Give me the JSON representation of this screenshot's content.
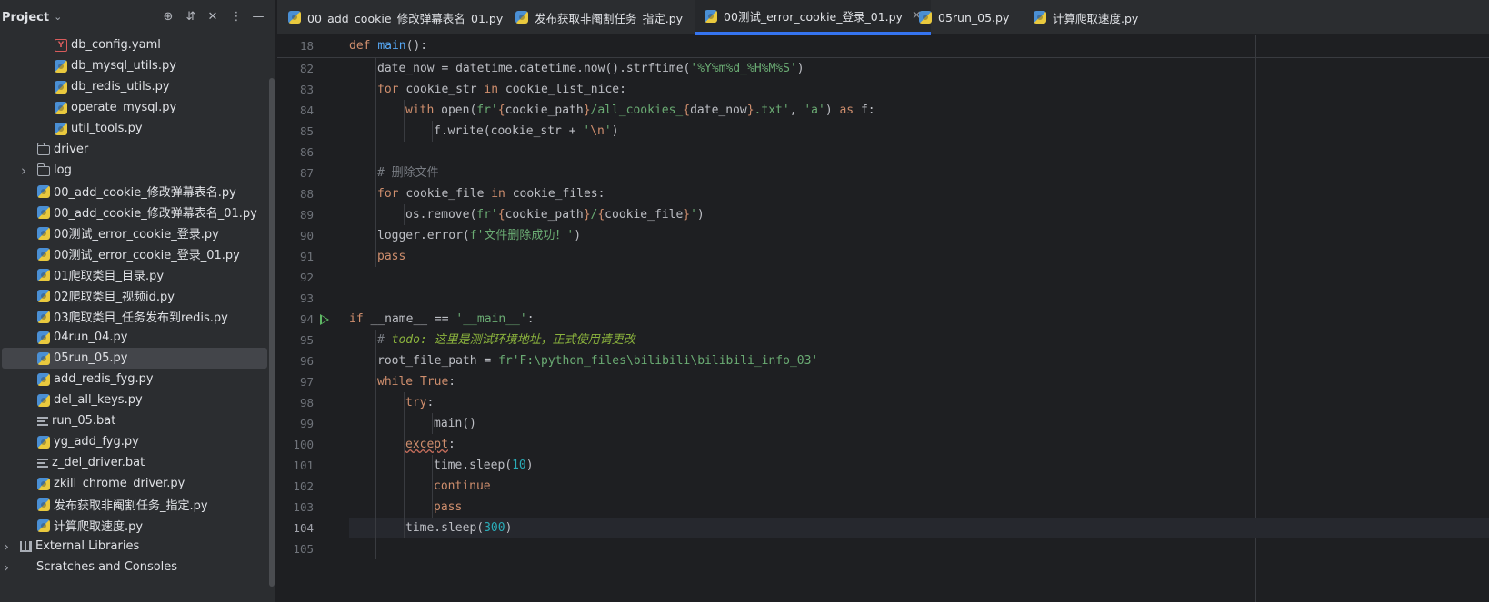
{
  "project_panel": {
    "title": "Project",
    "icons": [
      "locate-icon",
      "expand-all-icon",
      "collapse-all-icon",
      "more-options-icon",
      "minimize-icon"
    ],
    "tree": [
      {
        "label": "db_config.yaml",
        "icon": "yaml-file-icon",
        "indent": 60,
        "kind": "file"
      },
      {
        "label": "db_mysql_utils.py",
        "icon": "python-file-icon",
        "indent": 60,
        "kind": "file"
      },
      {
        "label": "db_redis_utils.py",
        "icon": "python-file-icon",
        "indent": 60,
        "kind": "file"
      },
      {
        "label": "operate_mysql.py",
        "icon": "python-file-icon",
        "indent": 60,
        "kind": "file"
      },
      {
        "label": "util_tools.py",
        "icon": "python-file-icon",
        "indent": 60,
        "kind": "file"
      },
      {
        "label": "driver",
        "icon": "folder-icon",
        "indent": 41,
        "kind": "folder"
      },
      {
        "label": "log",
        "icon": "folder-icon",
        "indent": 41,
        "kind": "folder",
        "expandable": true
      },
      {
        "label": "00_add_cookie_修改弹幕表名.py",
        "icon": "python-file-icon",
        "indent": 41,
        "kind": "file"
      },
      {
        "label": "00_add_cookie_修改弹幕表名_01.py",
        "icon": "python-file-icon",
        "indent": 41,
        "kind": "file"
      },
      {
        "label": "00测试_error_cookie_登录.py",
        "icon": "python-file-icon",
        "indent": 41,
        "kind": "file"
      },
      {
        "label": "00测试_error_cookie_登录_01.py",
        "icon": "python-file-icon",
        "indent": 41,
        "kind": "file"
      },
      {
        "label": "01爬取类目_目录.py",
        "icon": "python-file-icon",
        "indent": 41,
        "kind": "file"
      },
      {
        "label": "02爬取类目_视频id.py",
        "icon": "python-file-icon",
        "indent": 41,
        "kind": "file"
      },
      {
        "label": "03爬取类目_任务发布到redis.py",
        "icon": "python-file-icon",
        "indent": 41,
        "kind": "file"
      },
      {
        "label": "04run_04.py",
        "icon": "python-file-icon",
        "indent": 41,
        "kind": "file"
      },
      {
        "label": "05run_05.py",
        "icon": "python-file-icon",
        "indent": 41,
        "kind": "file",
        "selected": true
      },
      {
        "label": "add_redis_fyg.py",
        "icon": "python-file-icon",
        "indent": 41,
        "kind": "file"
      },
      {
        "label": "del_all_keys.py",
        "icon": "python-file-icon",
        "indent": 41,
        "kind": "file"
      },
      {
        "label": "run_05.bat",
        "icon": "bat-file-icon",
        "indent": 41,
        "kind": "file"
      },
      {
        "label": "yg_add_fyg.py",
        "icon": "python-file-icon",
        "indent": 41,
        "kind": "file"
      },
      {
        "label": "z_del_driver.bat",
        "icon": "bat-file-icon",
        "indent": 41,
        "kind": "file"
      },
      {
        "label": "zkill_chrome_driver.py",
        "icon": "python-file-icon",
        "indent": 41,
        "kind": "file"
      },
      {
        "label": "发布获取非阉割任务_指定.py",
        "icon": "python-file-icon",
        "indent": 41,
        "kind": "file"
      },
      {
        "label": "计算爬取速度.py",
        "icon": "python-file-icon",
        "indent": 41,
        "kind": "file"
      },
      {
        "label": "External Libraries",
        "icon": "library-icon",
        "indent": 22,
        "kind": "root",
        "expandable": true
      },
      {
        "label": "Scratches and Consoles",
        "icon": "scratches-icon",
        "indent": 22,
        "kind": "root",
        "expandable": true
      }
    ]
  },
  "tabs": [
    {
      "label": "00_add_cookie_修改弹幕表名_01.py",
      "active": false
    },
    {
      "label": "发布获取非阉割任务_指定.py",
      "active": false
    },
    {
      "label": "00测试_error_cookie_登录_01.py",
      "active": true
    },
    {
      "label": "05run_05.py",
      "active": false
    },
    {
      "label": "计算爬取速度.py",
      "active": false
    }
  ],
  "editor": {
    "current_line": "104",
    "run_marker_line": "94",
    "lines": [
      {
        "n": "18",
        "indent": 0,
        "tokens": [
          [
            "kw",
            "def "
          ],
          [
            "fn",
            "main"
          ],
          [
            "",
            "():"
          ]
        ]
      },
      {
        "n": "82",
        "indent": 1,
        "tokens": [
          [
            "",
            "date_now = datetime.datetime.now().strftime("
          ],
          [
            "str",
            "'%Y%m%d_%H%M%S'"
          ],
          [
            "",
            ")"
          ]
        ]
      },
      {
        "n": "83",
        "indent": 1,
        "tokens": [
          [
            "kw",
            "for "
          ],
          [
            "",
            "cookie_str "
          ],
          [
            "kw",
            "in "
          ],
          [
            "",
            "cookie_list_nice:"
          ]
        ]
      },
      {
        "n": "84",
        "indent": 2,
        "tokens": [
          [
            "kw",
            "with "
          ],
          [
            "",
            "open("
          ],
          [
            "str",
            "fr'"
          ],
          [
            "fmt",
            "{"
          ],
          [
            "",
            "cookie_path"
          ],
          [
            "fmt",
            "}"
          ],
          [
            "str",
            "/all_cookies_"
          ],
          [
            "fmt",
            "{"
          ],
          [
            "",
            "date_now"
          ],
          [
            "fmt",
            "}"
          ],
          [
            "str",
            ".txt'"
          ],
          [
            "",
            ", "
          ],
          [
            "str",
            "'a'"
          ],
          [
            "",
            ") "
          ],
          [
            "kw",
            "as "
          ],
          [
            "",
            "f:"
          ]
        ]
      },
      {
        "n": "85",
        "indent": 3,
        "tokens": [
          [
            "",
            "f.write(cookie_str + "
          ],
          [
            "str",
            "'"
          ],
          [
            "esc",
            "\\n"
          ],
          [
            "str",
            "'"
          ],
          [
            "",
            ")"
          ]
        ]
      },
      {
        "n": "86",
        "indent": 0,
        "tokens": []
      },
      {
        "n": "87",
        "indent": 1,
        "tokens": [
          [
            "cmt",
            "# 删除文件"
          ]
        ]
      },
      {
        "n": "88",
        "indent": 1,
        "tokens": [
          [
            "kw",
            "for "
          ],
          [
            "",
            "cookie_file "
          ],
          [
            "kw",
            "in "
          ],
          [
            "",
            "cookie_files:"
          ]
        ]
      },
      {
        "n": "89",
        "indent": 2,
        "tokens": [
          [
            "",
            "os.remove("
          ],
          [
            "str",
            "fr'"
          ],
          [
            "fmt",
            "{"
          ],
          [
            "",
            "cookie_path"
          ],
          [
            "fmt",
            "}"
          ],
          [
            "str",
            "/"
          ],
          [
            "fmt",
            "{"
          ],
          [
            "",
            "cookie_file"
          ],
          [
            "fmt",
            "}"
          ],
          [
            "str",
            "'"
          ],
          [
            "",
            ")"
          ]
        ]
      },
      {
        "n": "90",
        "indent": 1,
        "tokens": [
          [
            "",
            "logger.error("
          ],
          [
            "str",
            "f'文件删除成功！'"
          ],
          [
            "",
            ")"
          ]
        ]
      },
      {
        "n": "91",
        "indent": 1,
        "tokens": [
          [
            "kw",
            "pass"
          ]
        ]
      },
      {
        "n": "92",
        "indent": 0,
        "tokens": []
      },
      {
        "n": "93",
        "indent": 0,
        "tokens": []
      },
      {
        "n": "94",
        "indent": 0,
        "tokens": [
          [
            "kw",
            "if "
          ],
          [
            "",
            "__name__ == "
          ],
          [
            "str",
            "'__main__'"
          ],
          [
            "",
            ":"
          ]
        ]
      },
      {
        "n": "95",
        "indent": 1,
        "tokens": [
          [
            "cmt",
            "# "
          ],
          [
            "todo",
            "todo: 这里是测试环境地址，正式使用请更改"
          ]
        ]
      },
      {
        "n": "96",
        "indent": 1,
        "tokens": [
          [
            "",
            "root_file_path = "
          ],
          [
            "str",
            "fr'F:\\python_files\\bilibili\\bilibili_info_03'"
          ]
        ]
      },
      {
        "n": "97",
        "indent": 1,
        "tokens": [
          [
            "kw",
            "while True"
          ],
          [
            "",
            ":"
          ]
        ]
      },
      {
        "n": "98",
        "indent": 2,
        "tokens": [
          [
            "kw",
            "try"
          ],
          [
            "",
            ":"
          ]
        ]
      },
      {
        "n": "99",
        "indent": 3,
        "tokens": [
          [
            "",
            "main()"
          ]
        ]
      },
      {
        "n": "100",
        "indent": 2,
        "tokens": [
          [
            "kw wavy",
            "except"
          ],
          [
            "",
            ":"
          ]
        ]
      },
      {
        "n": "101",
        "indent": 3,
        "tokens": [
          [
            "",
            "time.sleep("
          ],
          [
            "num",
            "10"
          ],
          [
            "",
            ")"
          ]
        ]
      },
      {
        "n": "102",
        "indent": 3,
        "tokens": [
          [
            "kw",
            "continue"
          ]
        ]
      },
      {
        "n": "103",
        "indent": 3,
        "tokens": [
          [
            "kw",
            "pass"
          ]
        ]
      },
      {
        "n": "104",
        "indent": 2,
        "tokens": [
          [
            "",
            "time.sleep("
          ],
          [
            "num",
            "300"
          ],
          [
            "",
            ")"
          ]
        ]
      },
      {
        "n": "105",
        "indent": 0,
        "tokens": []
      }
    ]
  }
}
